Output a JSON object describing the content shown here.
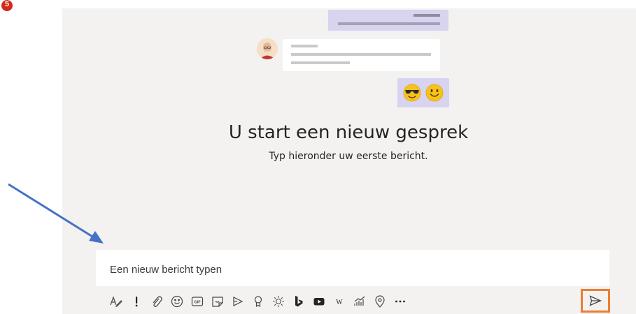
{
  "step": {
    "number": "5"
  },
  "conversation": {
    "title": "U start een nieuw gesprek",
    "subtitle": "Typ hieronder uw eerste bericht."
  },
  "compose": {
    "placeholder": "Een nieuw bericht typen"
  },
  "toolbar": {
    "icons": [
      "format-icon",
      "important-icon",
      "attach-icon",
      "emoji-icon",
      "gif-icon",
      "sticker-icon",
      "meet-now-icon",
      "praise-icon",
      "sun-icon",
      "bing-icon",
      "youtube-icon",
      "wikipedia-icon",
      "chart-icon",
      "location-icon",
      "more-icon",
      "send-icon"
    ]
  },
  "colors": {
    "panel": "#f3f2f1",
    "bubble_purple": "#d8d3ee",
    "highlight": "#ed7d31",
    "arrow": "#4472c4",
    "icon": "#484644",
    "badge": "#d42a1a"
  }
}
